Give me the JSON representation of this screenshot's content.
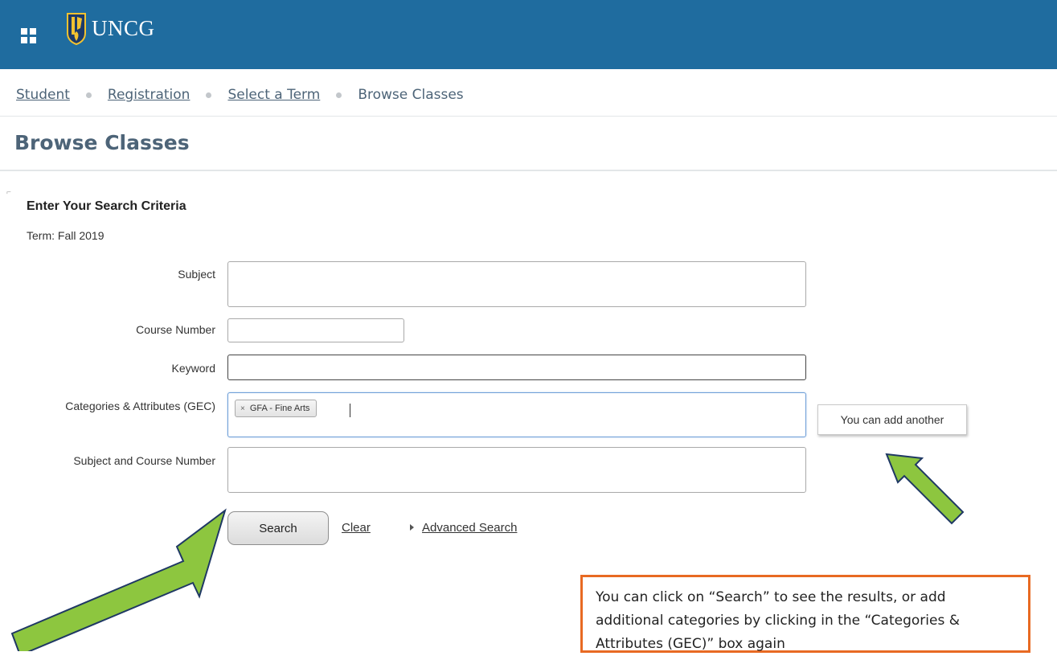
{
  "header": {
    "brand_text": "UNCG",
    "bar_color": "#1f6c9f",
    "menu_icon": "grid-menu-icon"
  },
  "breadcrumb": {
    "items": [
      "Student",
      "Registration",
      "Select a Term"
    ],
    "current": "Browse Classes"
  },
  "page": {
    "title": "Browse Classes"
  },
  "search": {
    "heading": "Enter Your Search Criteria",
    "term_text": "Term: Fall 2019",
    "fields": {
      "subject": {
        "label": "Subject",
        "value": ""
      },
      "course_number": {
        "label": "Course Number",
        "value": ""
      },
      "keyword": {
        "label": "Keyword",
        "value": ""
      },
      "categories": {
        "label": "Categories & Attributes (GEC)",
        "tags": [
          "GFA - Fine Arts"
        ],
        "remove_icon": "×"
      },
      "subject_course": {
        "label": "Subject and Course Number",
        "value": ""
      }
    },
    "tooltip": "You can add another",
    "search_button": "Search",
    "clear_link": "Clear",
    "advanced_link": "Advanced Search"
  },
  "annotations": {
    "callout_text": "You can click on “Search” to see the results, or add additional categories by clicking in the “Categories & Attributes (GEC)” box again",
    "arrow_color": "#8dc63f",
    "callout_border_color": "#e86a23"
  }
}
